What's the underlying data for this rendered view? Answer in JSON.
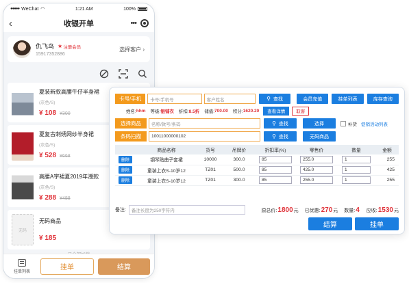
{
  "status_bar": {
    "carrier": "WeChat",
    "time": "1:21 AM",
    "battery": "100%"
  },
  "nav": {
    "title": "收银开单"
  },
  "customer": {
    "name": "仇飞鸟",
    "badge": "注册会员",
    "phone": "15917352886",
    "select_label": "选择客户"
  },
  "products": [
    {
      "name": "夏装新款高腰牛仔半身裙",
      "spec": "(灰色/S)",
      "price": "¥ 108",
      "old_price": "¥300"
    },
    {
      "name": "夏复古刺绣网纱半身裙",
      "spec": "(灰色/S)",
      "price": "¥ 528",
      "old_price": "¥668"
    },
    {
      "name": "高腰A字裙夏2019年潮款",
      "spec": "(灰色/S)",
      "price": "¥ 288",
      "old_price": "¥488"
    },
    {
      "name": "无码商品",
      "spec": "",
      "price": "¥ 185",
      "old_price": "",
      "thumb_text": "无码"
    }
  ],
  "footer_note": "— 已全部加载 —",
  "bottom_bar": {
    "hold_list": "挂单列表",
    "hold": "挂单",
    "pay": "结算"
  },
  "pos": {
    "card_label": "卡号/手机",
    "card_placeholder": "卡号/手机号",
    "name_placeholder": "客户姓名",
    "search": "查找",
    "recharge": "会员充值",
    "hold_list": "挂单列表",
    "stock_query": "库存查询",
    "member": {
      "name_k": "姓名:",
      "name_v": "hhm",
      "level_k": "等级:",
      "level_v": "银铺衣",
      "discount_k": "折扣:",
      "discount_v": "8.5折",
      "stored_k": "储值:",
      "stored_v": "700.00",
      "points_k": "积分:",
      "points_v": "1620.20",
      "detail": "查看详情",
      "cancel": "取客"
    },
    "select_goods_label": "选择商品",
    "select_goods_placeholder": "名称/款号/条码",
    "select_btn": "选择",
    "reverse_label": "补货",
    "activity_link": "促销活动列表",
    "barcode_label": "条码扫描",
    "barcode_value": "10011000000102",
    "no_code_btn": "无码商品",
    "table": {
      "headers": [
        "",
        "商品名称",
        "货号",
        "吊牌价",
        "折扣率(%)",
        "零售价",
        "数量",
        "金额"
      ],
      "rows": [
        {
          "del": "删除",
          "name": "钢琴贴曲子套裙",
          "code": "10000",
          "tag": "300.0",
          "discount": "85",
          "retail": "255.0",
          "qty": "1",
          "amount": "255"
        },
        {
          "del": "删除",
          "name": "童装上衣S-10岁12",
          "code": "TZ01",
          "tag": "500.0",
          "discount": "85",
          "retail": "425.0",
          "qty": "1",
          "amount": "425"
        },
        {
          "del": "删除",
          "name": "童装上衣S-10岁12",
          "code": "TZ01",
          "tag": "300.0",
          "discount": "85",
          "retail": "255.0",
          "qty": "1",
          "amount": "255"
        }
      ]
    },
    "remark_label": "备注:",
    "remark_placeholder": "备注长度为250字符内",
    "total_k": "原总价:",
    "total_v": "1800",
    "unit": "元",
    "discount_total_k": "已优惠:",
    "discount_total_v": "270",
    "qty_k": "数量:",
    "qty_v": "4",
    "receivable_k": "应收:",
    "receivable_v": "1530",
    "pay": "结算",
    "hold": "挂单"
  }
}
